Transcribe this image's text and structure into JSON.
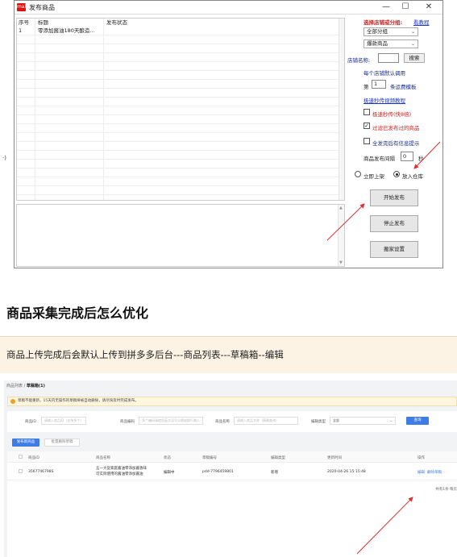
{
  "window": {
    "title": "发布商品",
    "logo_text": "mall",
    "minimize": "—",
    "maximize": "☐",
    "close": "✕"
  },
  "list": {
    "columns": [
      "序号",
      "标题",
      "发布状态"
    ],
    "rows": [
      {
        "index": "1",
        "title": "零添加酱油180天酿造…",
        "status": ""
      }
    ]
  },
  "panel": {
    "group_label": "选择店铺或分组:",
    "tutorial_link": "看教程",
    "group_select": "全部分组",
    "category_select": "爆款商品",
    "shop_name_label": "店铺名称:",
    "shop_name_value": "",
    "search_button": "搜索",
    "default_template_label": "每个店铺默认调用",
    "nth_prefix": "第",
    "nth_value": "1",
    "nth_suffix": "条运费模板",
    "video_link": "极速秒传视频教程",
    "speed_checkbox_label": "极速秒传(快8倍)",
    "speed_checked": false,
    "filter_checkbox_label": "过滤已发布过的商品",
    "filter_checked": true,
    "notice_checkbox_label": "全发完后有信息提示",
    "notice_checked": false,
    "interval_label": "商品发布间隔",
    "interval_value": "0",
    "interval_unit": "秒",
    "radio_list_now": "立即上架",
    "radio_warehouse": "放入仓库",
    "selected_radio": "放入仓库",
    "start_button": "开始发布",
    "stop_button": "停止发布",
    "settings_button": "搬家设置",
    "left_edge_mark": "·)"
  },
  "article": {
    "heading": "商品采集完成后怎么优化",
    "tip": "商品上传完成后会默认上传到拼多多后台---商品列表---草稿箱--编辑"
  },
  "admin": {
    "breadcrumb_parent": "商品列表 /",
    "breadcrumb_current": "草稿箱(1)",
    "notice": "草稿不能重新，15天内无操作的草稿将被自动删除，请尽快及时完成发布。",
    "filters": [
      {
        "label": "商品ID",
        "placeholder": "请输入商品ID（支持多个）"
      },
      {
        "label": "商品编码",
        "placeholder": "多个编码请使用英文逗号分隔或换行输入"
      },
      {
        "label": "商品名称",
        "placeholder": "请输入商品名称（精确查询）"
      },
      {
        "label": "编辑类型",
        "placeholder": "全部"
      }
    ],
    "query_button": "查询",
    "tab_active": "发布新商品",
    "tab_other": "批量删除草稿",
    "columns": [
      "商品ID",
      "商品名称",
      "状态",
      "草稿编号",
      "编辑类型",
      "更新时间",
      "操作"
    ],
    "row": {
      "id": "3567746798S",
      "name_line1": "五一大促家庭酱油零添加酱香味",
      "name_line2": "可实际使用的酱油零添加酱油",
      "status": "编辑中",
      "draft_no": "pdd-7796459801",
      "edit_type": "新增",
      "updated": "2020-04-26 15:15:48",
      "op_edit": "编辑",
      "op_delete": "删除草稿"
    },
    "pager": "共有1条 每页"
  },
  "colors": {
    "accent_red": "#d02020",
    "link_blue": "#1a33c8",
    "admin_blue": "#3e7ce6",
    "arrow_red": "#e03030",
    "tip_bg": "#fdf3e4"
  }
}
